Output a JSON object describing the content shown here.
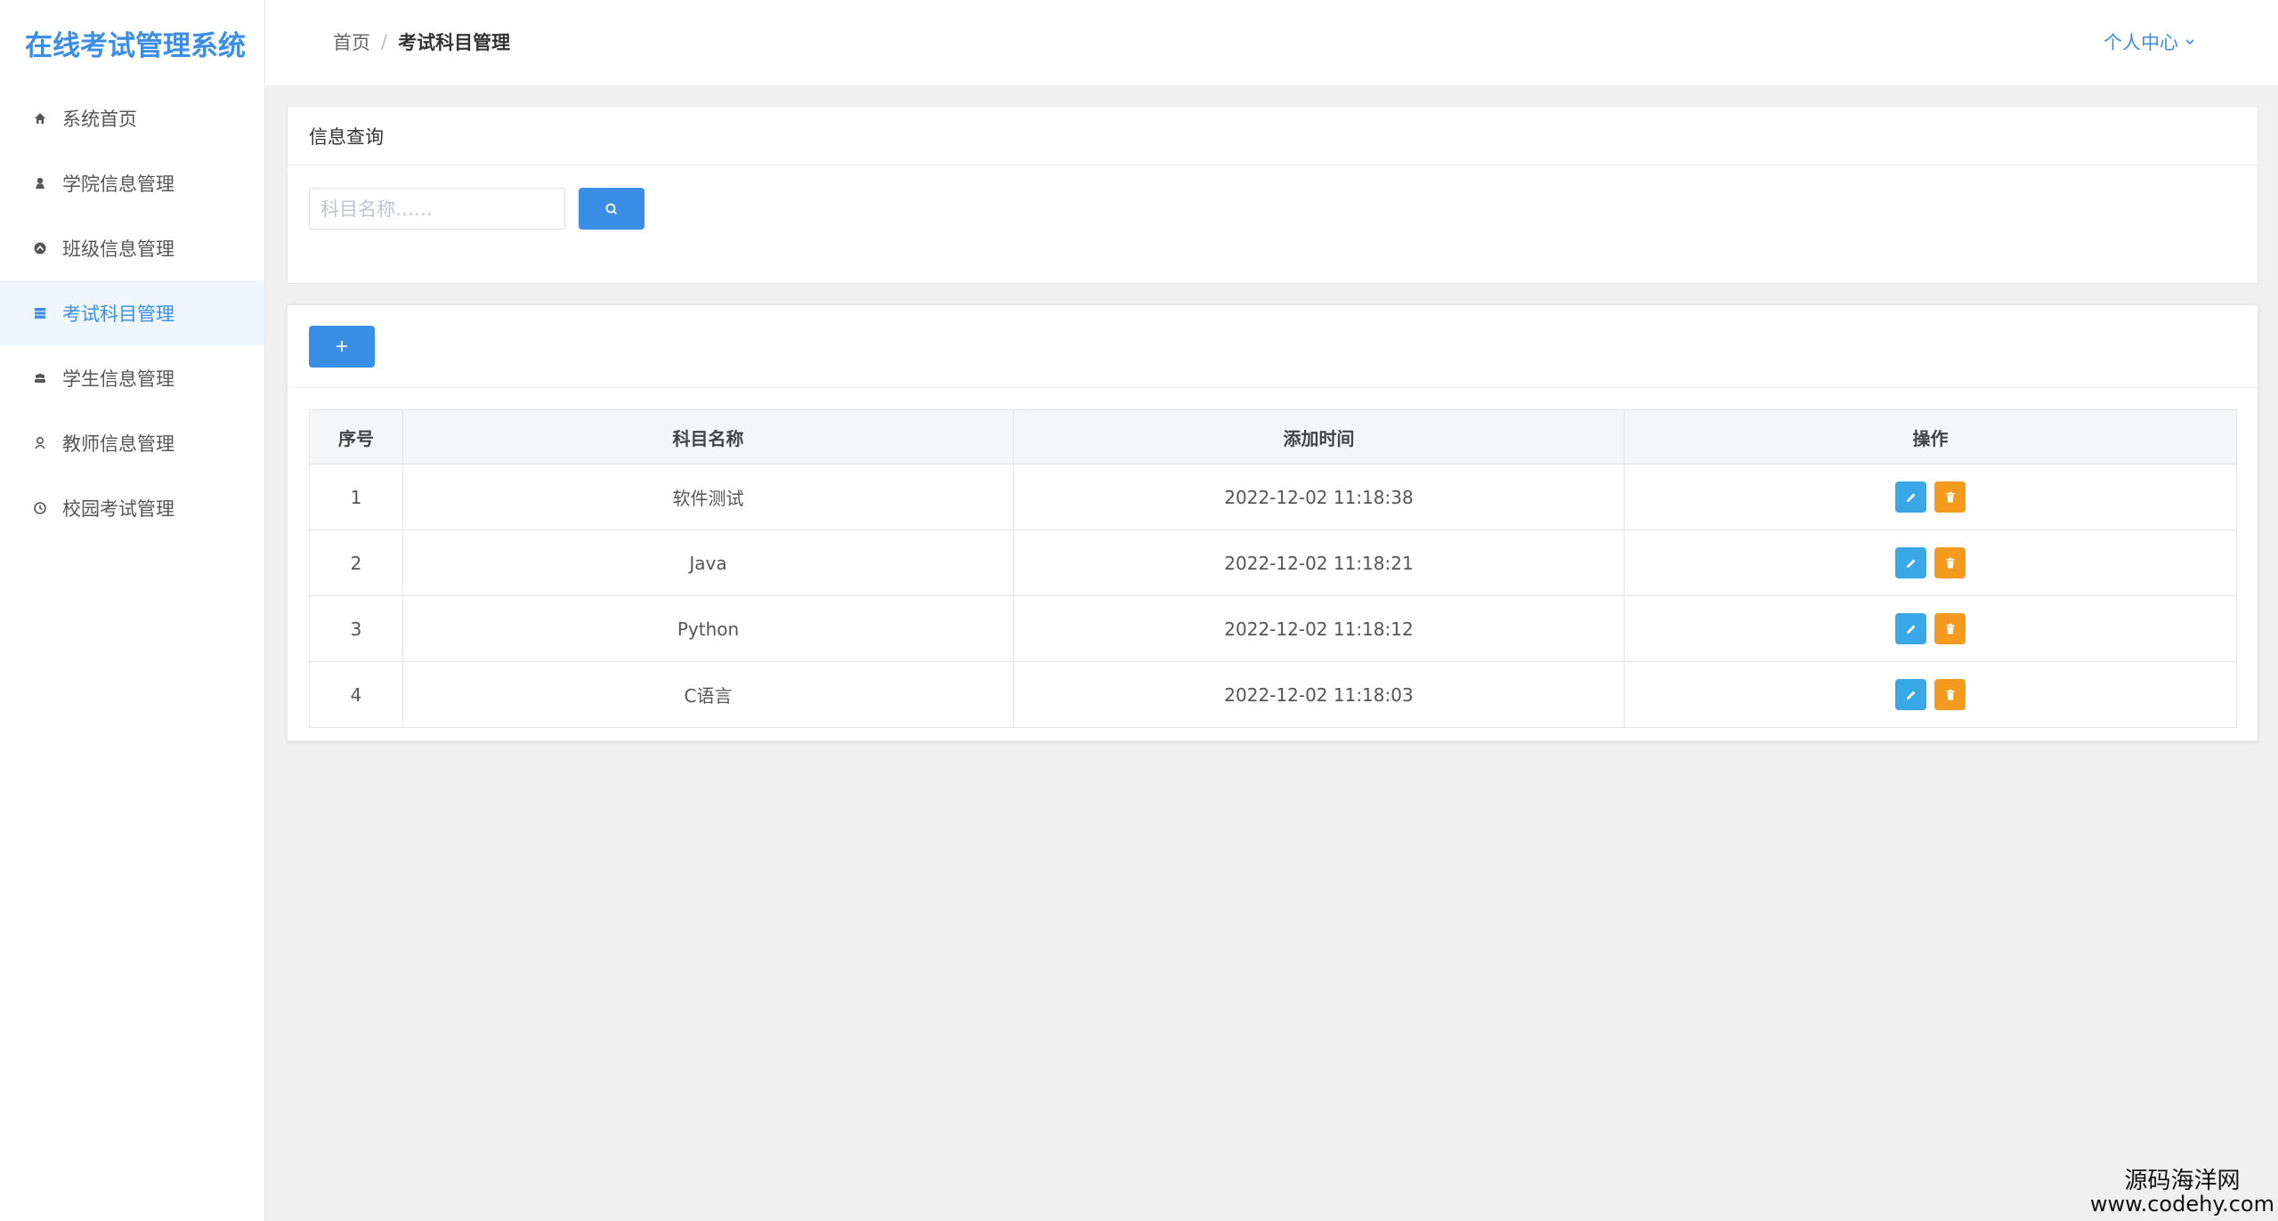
{
  "app": {
    "title": "在线考试管理系统"
  },
  "sidebar": {
    "items": [
      {
        "label": "系统首页",
        "icon": "home-icon",
        "active": false
      },
      {
        "label": "学院信息管理",
        "icon": "user-icon",
        "active": false
      },
      {
        "label": "班级信息管理",
        "icon": "circle-icon",
        "active": false
      },
      {
        "label": "考试科目管理",
        "icon": "list-icon",
        "active": true
      },
      {
        "label": "学生信息管理",
        "icon": "users-icon",
        "active": false
      },
      {
        "label": "教师信息管理",
        "icon": "person-icon",
        "active": false
      },
      {
        "label": "校园考试管理",
        "icon": "clock-icon",
        "active": false
      }
    ]
  },
  "header": {
    "breadcrumb": {
      "home": "首页",
      "separator": "/",
      "current": "考试科目管理"
    },
    "user_menu": "个人中心"
  },
  "query": {
    "title": "信息查询",
    "input_value": "",
    "placeholder": "科目名称……"
  },
  "table": {
    "add_label": "+",
    "columns": [
      "序号",
      "科目名称",
      "添加时间",
      "操作"
    ],
    "rows": [
      {
        "index": "1",
        "name": "软件测试",
        "time": "2022-12-02 11:18:38"
      },
      {
        "index": "2",
        "name": "Java",
        "time": "2022-12-02 11:18:21"
      },
      {
        "index": "3",
        "name": "Python",
        "time": "2022-12-02 11:18:12"
      },
      {
        "index": "4",
        "name": "C语言",
        "time": "2022-12-02 11:18:03"
      }
    ]
  },
  "colors": {
    "accent": "#3a8ee6",
    "edit": "#3aa8e8",
    "delete": "#f49b1f",
    "active_bg": "#eef6fe"
  },
  "watermark": {
    "line1": "源码海洋网",
    "line2": "www.codehy.com"
  }
}
